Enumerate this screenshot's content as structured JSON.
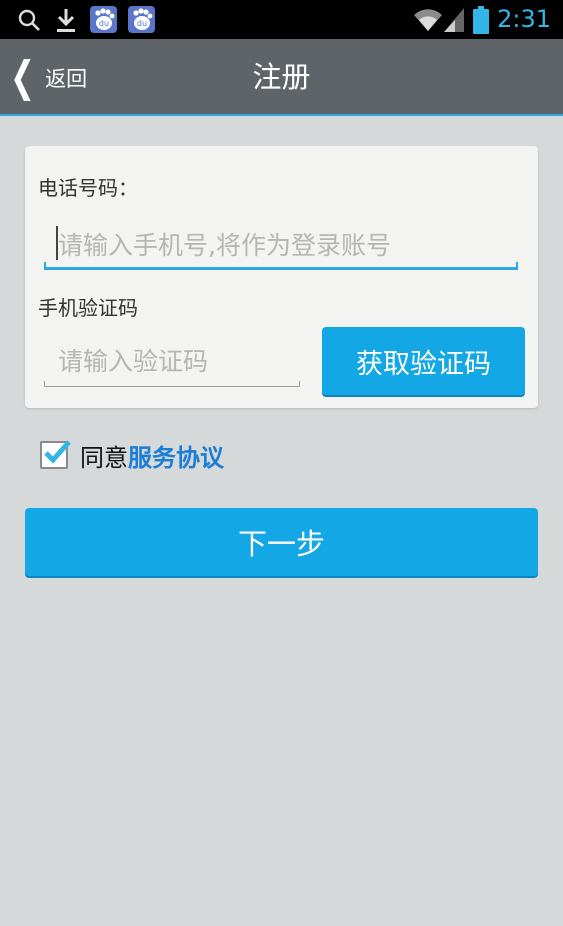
{
  "status_bar": {
    "time": "2:31",
    "icons": [
      "search-icon",
      "download-icon",
      "baidu-icon",
      "baidu-icon",
      "wifi-icon",
      "signal-icon",
      "battery-icon"
    ]
  },
  "header": {
    "back_label": "返回",
    "title": "注册"
  },
  "form": {
    "phone_label": "电话号码：",
    "phone_placeholder": "请输入手机号,将作为登录账号",
    "code_label": "手机验证码",
    "code_placeholder": "请输入验证码",
    "get_code_label": "获取验证码"
  },
  "agreement": {
    "checked": true,
    "text": "同意",
    "link_text": "服务协议"
  },
  "next_button": {
    "label": "下一步"
  },
  "colors": {
    "accent": "#14a7e6",
    "link": "#1a7dd6",
    "header_bg": "#5e6468",
    "page_bg": "#d5d9da",
    "time": "#33b5e5"
  }
}
